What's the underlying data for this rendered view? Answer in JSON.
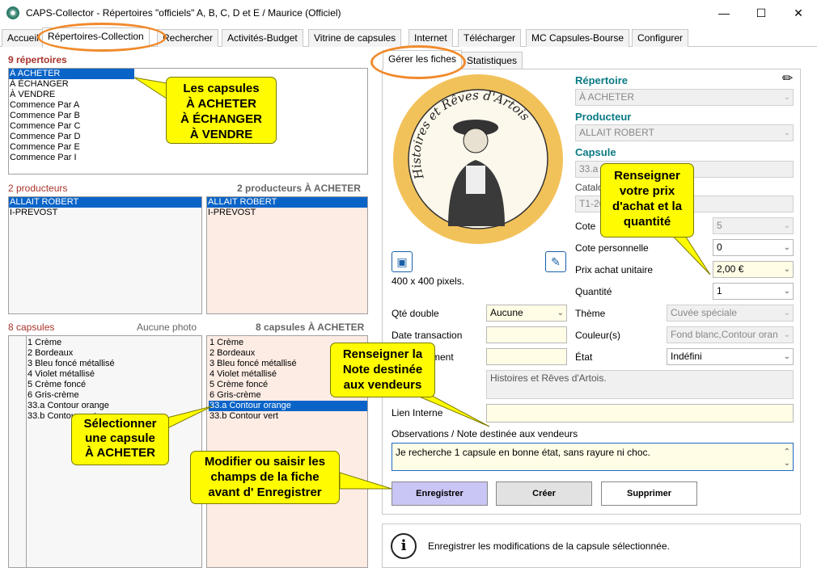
{
  "window": {
    "title": "CAPS-Collector - Répertoires \"officiels\" A, B, C, D et E / Maurice (Officiel)",
    "minimize": "—",
    "maximize": "☐",
    "close": "✕"
  },
  "tabs": [
    "Accueil",
    "Répertoires-Collection",
    "Rechercher",
    "Activités-Budget",
    "Vitrine de capsules",
    "Internet",
    "Télécharger",
    "MC Capsules-Bourse",
    "Configurer"
  ],
  "left": {
    "repertoires_header": "9 répertoires",
    "repertoires": [
      "À ACHETER",
      "À ÉCHANGER",
      "À VENDRE",
      "Commence Par A",
      "Commence Par B",
      "Commence Par C",
      "Commence Par D",
      "Commence Par E",
      "Commence Par I"
    ],
    "producteurs_header": "2 producteurs",
    "producteurs_header_right": "2 producteurs À ACHETER",
    "producteurs": [
      "ALLAIT ROBERT",
      "I-PREVOST"
    ],
    "producteurs_right": [
      "ALLAIT ROBERT",
      "I-PREVOST"
    ],
    "capsules_header": "8 capsules",
    "no_photo": "Aucune photo",
    "capsules_header_right": "8 capsules À ACHETER",
    "capsules": [
      "1 Crème",
      "2 Bordeaux",
      "3 Bleu foncé métallisé",
      "4 Violet métallisé",
      "5 Crème foncé",
      "6 Gris-crème",
      "33.a Contour orange",
      "33.b Contour vert"
    ],
    "capsules_right": [
      "1 Crème",
      "2 Bordeaux",
      "3 Bleu foncé métallisé",
      "4 Violet métallisé",
      "5 Crème foncé",
      "6 Gris-crème",
      "33.a Contour orange",
      "33.b Contour vert"
    ]
  },
  "callouts": {
    "c1": [
      "Les capsules",
      "À ACHETER",
      "À ÉCHANGER",
      "À VENDRE"
    ],
    "c2": [
      "Renseigner",
      "votre prix",
      "d'achat et la",
      "quantité"
    ],
    "c3": [
      "Renseigner la",
      "Note destinée",
      "aux vendeurs"
    ],
    "c4": [
      "Sélectionner",
      "une capsule",
      "À ACHETER"
    ],
    "c5": [
      "Modifier ou saisir les",
      "champs de la fiche",
      "avant d' Enregistrer"
    ]
  },
  "right": {
    "subtabs": [
      "Gérer les fiches",
      "Statistiques"
    ],
    "image_text": "Histoires et Rêves d'Artois",
    "pixels": "400 x 400 pixels.",
    "repertoire_label": "Répertoire",
    "repertoire_value": "À ACHETER",
    "producteur_label": "Producteur",
    "producteur_value": "ALLAIT ROBERT",
    "capsule_label": "Capsule",
    "capsule_value": "33.a C",
    "catalogue_label": "Catalo",
    "catalogue_value": "T1-26",
    "cote_label": "Cote",
    "cote_value": "5",
    "cote_perso_label": "Cote personnelle",
    "cote_perso_value": "0",
    "prix_label": "Prix achat unitaire",
    "prix_value": "2,00 €",
    "quantite_label": "Quantité",
    "quantite_value": "1",
    "qte_double_label": "Qté double",
    "qte_double_value": "Aucune",
    "theme_label": "Thème",
    "theme_value": "Cuvée spéciale",
    "date_label": "Date transaction",
    "couleurs_label": "Couleur(s)",
    "couleurs_value": "Fond blanc,Contour oran",
    "comment_label": "ment",
    "etat_label": "État",
    "etat_value": "Indéfini",
    "description_value": "Histoires et Rêves d'Artois.",
    "lien_label": "Lien Interne",
    "obs_label": "Observations / Note destinée aux vendeurs",
    "obs_value": "Je recherche 1 capsule en bonne état, sans rayure ni choc.",
    "btn_save": "Enregistrer",
    "btn_create": "Créer",
    "btn_delete": "Supprimer",
    "status_text": "Enregistrer les modifications de la capsule sélectionnée."
  }
}
